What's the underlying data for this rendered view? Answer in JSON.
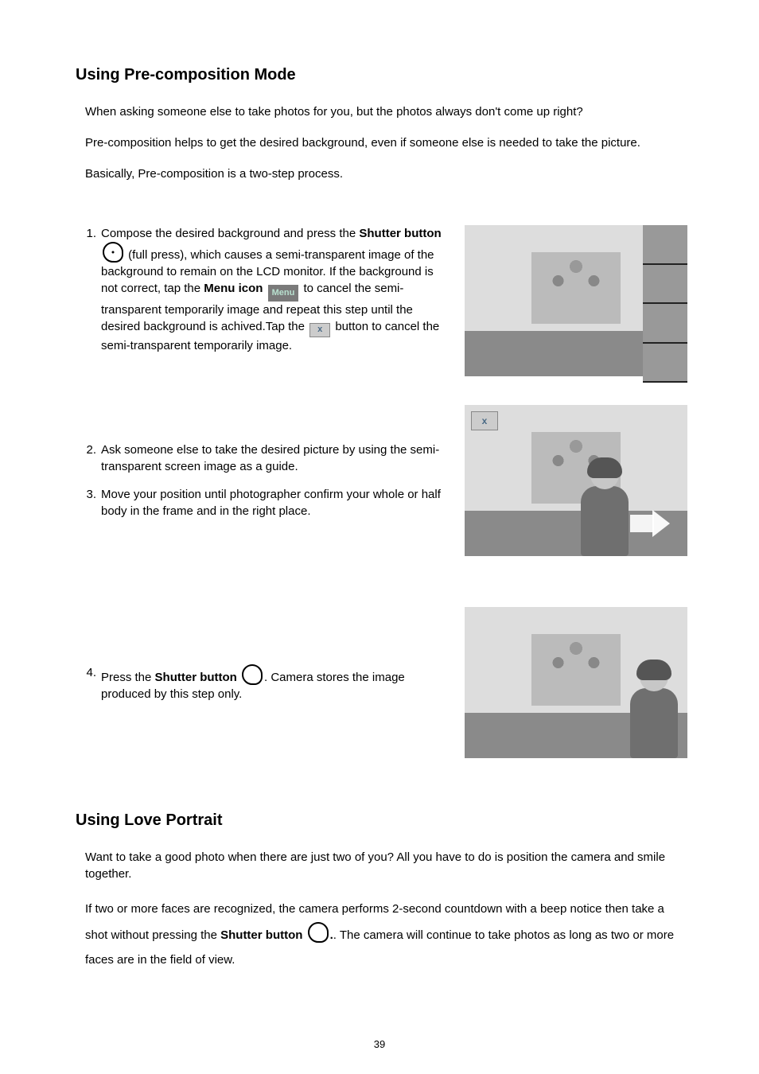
{
  "page_number": "39",
  "section1": {
    "heading": "Using Pre-composition Mode",
    "intro1": "When asking someone else to take photos for you, but the photos always don't come up right?",
    "intro2": "Pre-composition helps to get the desired background, even if someone else is needed to take the picture.",
    "intro3": "Basically, Pre-composition is a two-step process.",
    "step1_num": "1.",
    "step1_a": "Compose the desired background and press the ",
    "step1_bold1": "Shutter button",
    "step1_b": " (full press), which causes a semi-transparent image of the background to remain on the LCD monitor.  If the background is not correct, tap the ",
    "step1_bold2": "Menu icon",
    "step1_c": " to cancel the semi-transparent temporarily image and repeat this step until the desired background is achived.Tap the ",
    "step1_d": " button to cancel the semi-transparent temporarily image.",
    "menu_chip": "Menu",
    "step2_num": "2.",
    "step2": "Ask someone else to take the desired picture by using the  semi-transparent screen image as a guide.",
    "step3_num": "3.",
    "step3": "Move your position until photographer confirm your whole or half body in the frame and in the right place.",
    "step4_num": "4.",
    "step4_a": "Press the ",
    "step4_bold": "Shutter button ",
    "step4_b": ". Camera stores the image produced by this step only."
  },
  "section2": {
    "heading": "Using Love Portrait",
    "para1": "Want to take a good photo when there are just two of you?  All you have to do is position the camera and smile together.",
    "para2_a": "If two or more faces are recognized, the camera performs 2-second countdown with a beep notice then take a shot without pressing the ",
    "para2_bold": "Shutter button ",
    "para2_b": ".  The camera will continue to take photos as long as two or more faces are in the field of view."
  }
}
